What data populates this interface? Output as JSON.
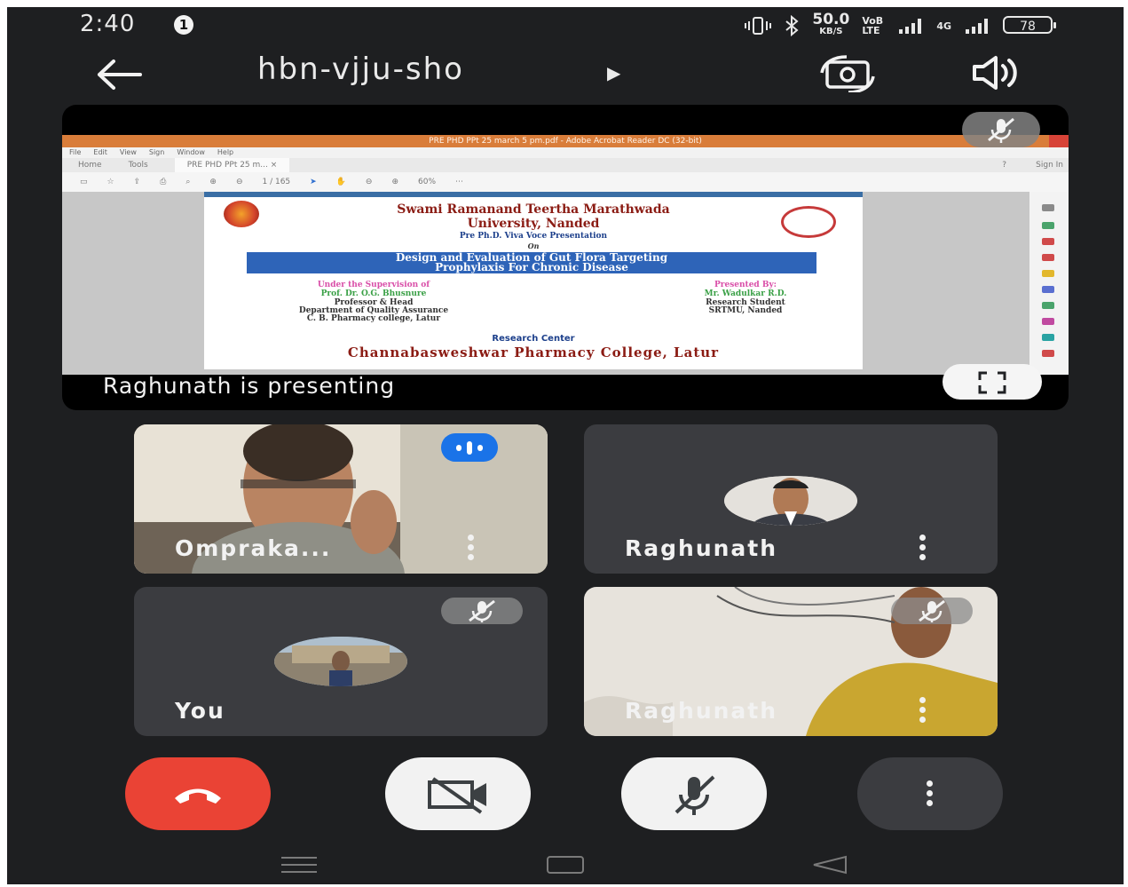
{
  "status_bar": {
    "time": "2:40",
    "notification_count": "1",
    "speed_value": "50.0",
    "speed_unit": "KB/S",
    "volte_label": "VoB LTE",
    "net_label": "4G",
    "battery": "78"
  },
  "meeting": {
    "code": "hbn-vjju-sho",
    "presenting_caption": "Raghunath is presenting"
  },
  "acrobat": {
    "window_title": "PRE PHD PPt 25 march 5 pm.pdf - Adobe Acrobat Reader DC (32-bit)",
    "menu": [
      "File",
      "Edit",
      "View",
      "Sign",
      "Window",
      "Help"
    ],
    "tabs": [
      "Home",
      "Tools",
      "PRE PHD PPt 25 m... ×"
    ],
    "sign_in": "Sign In",
    "page_indicator": "1  /  165",
    "zoom": "60%"
  },
  "slide": {
    "university_line1": "Swami Ramanand Teertha Marathwada",
    "university_line2": "University, Nanded",
    "presentation_type": "Pre Ph.D. Viva Voce Presentation",
    "on": "On",
    "topic_line1": "Design and Evaluation of Gut Flora Targeting",
    "topic_line2": "Prophylaxis For Chronic Disease",
    "supervision_heading": "Under the Supervision of",
    "supervisor_name": "Prof. Dr. O.G. Bhusnure",
    "supervisor_title": "Professor & Head",
    "supervisor_dept": "Department of Quality Assurance",
    "supervisor_college": "C. B. Pharmacy college, Latur",
    "presented_heading": "Presented By:",
    "presenter_name": "Mr. Wadulkar R.D.",
    "presenter_title": "Research Student",
    "presenter_inst": "SRTMU, Nanded",
    "research_center": "Research Center",
    "college": "Channabasweshwar Pharmacy College, Latur"
  },
  "participants": [
    {
      "name": "Omprakа...",
      "muted": false,
      "speaking": true
    },
    {
      "name": "Raghunath",
      "muted": false,
      "speaking": false
    },
    {
      "name": "You",
      "muted": true,
      "speaking": false
    },
    {
      "name": "Raghunath",
      "muted": true,
      "speaking": false
    }
  ],
  "colors": {
    "background": "#1e1f21",
    "tile": "#3b3c40",
    "end_call": "#ea4335",
    "speaking_badge": "#1a73e8",
    "slide_band": "#2e64b8",
    "slide_title": "#8b1c14"
  },
  "icons": {
    "back": "arrow-left-icon",
    "switch_camera": "flip-camera-icon",
    "audio_output": "speaker-icon",
    "fullscreen": "fullscreen-icon",
    "end_call": "phone-hangup-icon",
    "camera": "camera-off-icon",
    "mic": "mic-off-icon",
    "more": "more-vertical-icon"
  }
}
